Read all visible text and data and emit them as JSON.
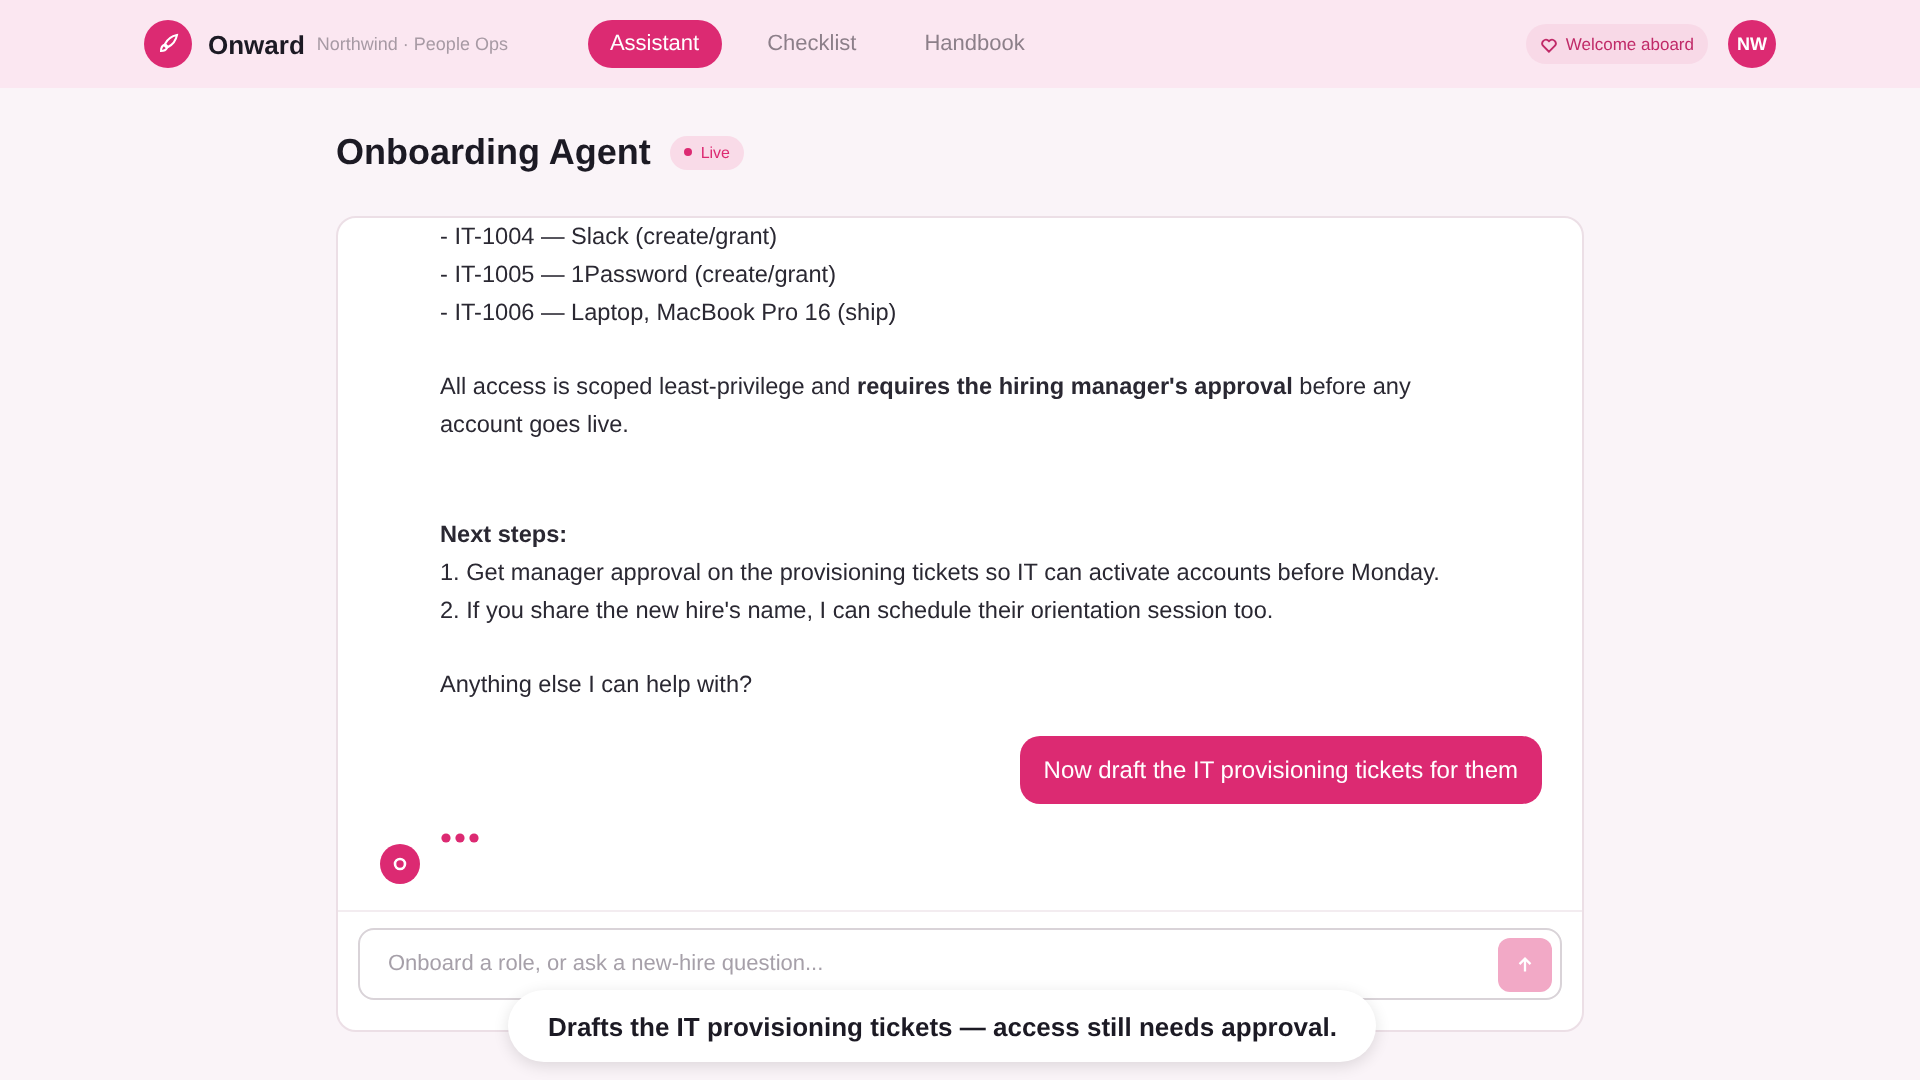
{
  "header": {
    "brand": "Onward",
    "org": "Northwind · People Ops",
    "nav": [
      {
        "label": "Assistant",
        "selected": true
      },
      {
        "label": "Checklist",
        "selected": false
      },
      {
        "label": "Handbook",
        "selected": false
      }
    ],
    "welcome": "Welcome aboard",
    "avatar": "NW"
  },
  "page": {
    "title": "Onboarding Agent",
    "status": "Live"
  },
  "messages": [
    {
      "kind": "reply",
      "paragraphs": [
        {
          "kind": "lines",
          "lines": [
            "- IT-1004 — Slack (create/grant)",
            "- IT-1005 — 1Password (create/grant)",
            "- IT-1006 — Laptop, MacBook Pro 16 (ship)"
          ]
        },
        {
          "kind": "lines",
          "lines": [
            "All access is scoped least-privilege and **requires the hiring manager's approval** before any account goes live."
          ]
        },
        {
          "kind": "section",
          "heading": "Next steps:",
          "lines": [
            "1. Get manager approval on the provisioning tickets so IT can activate accounts before Monday.",
            "2. If you share the new hire's name, I can schedule their orientation session too."
          ]
        },
        {
          "kind": "lines",
          "lines": [
            "Anything else I can help with?"
          ]
        }
      ]
    },
    {
      "kind": "prompt",
      "text": "Now draft the IT provisioning tickets for them"
    }
  ],
  "typing": true,
  "composer": {
    "placeholder": "Onboard a role, or ask a new-hire question...",
    "send_disabled": true
  },
  "caption": "Drafts the IT provisioning tickets — access still needs approval."
}
